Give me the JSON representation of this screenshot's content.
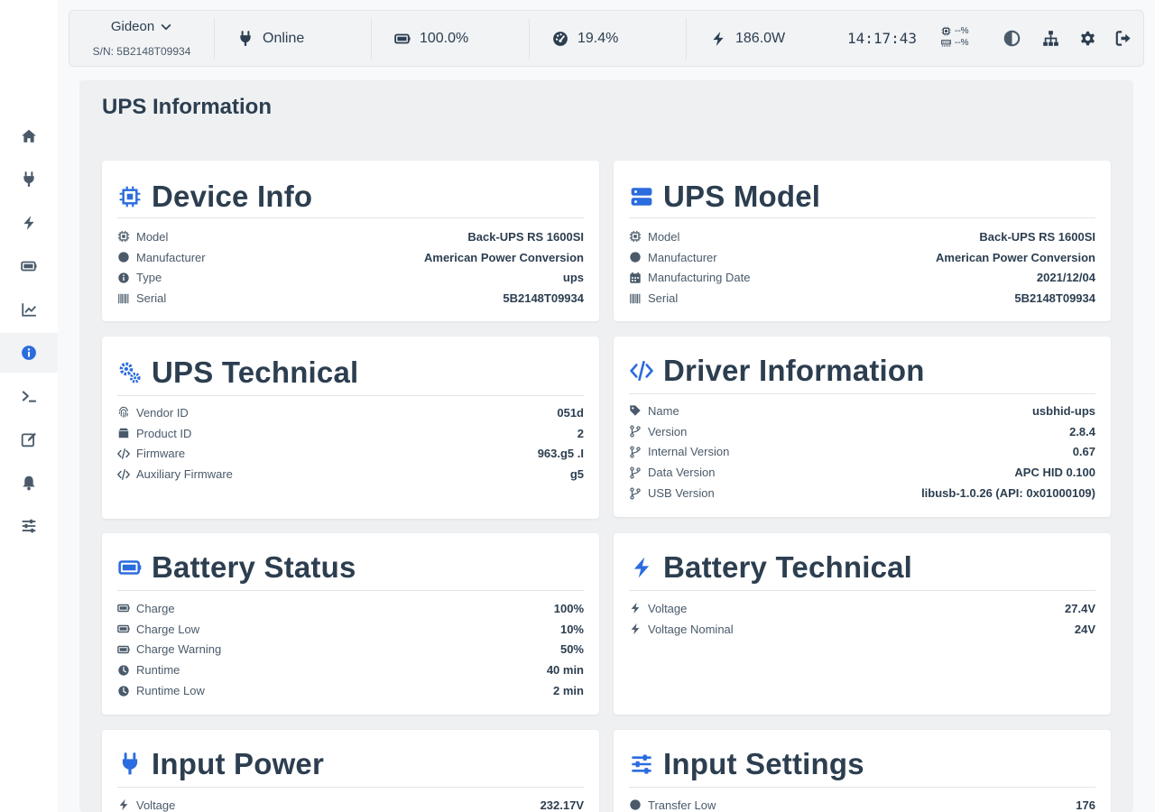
{
  "colors": {
    "accent": "#2b6cde",
    "text": "#2c3e50",
    "muted": "#4a5a6a",
    "icon": "#4a5a6a"
  },
  "sidebar": {
    "items": [
      {
        "icon": "home-icon"
      },
      {
        "icon": "plug-icon"
      },
      {
        "icon": "bolt-icon"
      },
      {
        "icon": "battery-icon"
      },
      {
        "icon": "chart-line-icon"
      },
      {
        "icon": "info-icon",
        "active": true
      },
      {
        "icon": "terminal-icon"
      },
      {
        "icon": "edit-icon"
      },
      {
        "icon": "bell-icon"
      },
      {
        "icon": "sliders-icon"
      }
    ]
  },
  "header": {
    "device_name": "Gideon",
    "serial": "S/N: 5B2148T09934",
    "status": "Online",
    "battery": "100.0%",
    "load": "19.4%",
    "power": "186.0W",
    "time": "14:17:43",
    "cpu": "--%",
    "memory": "--%"
  },
  "page": {
    "title": "UPS Information"
  },
  "cards": {
    "device_info": {
      "title": "Device Info",
      "rows": [
        {
          "label": "Model",
          "value": "Back-UPS RS 1600SI",
          "icon": "chip-icon"
        },
        {
          "label": "Manufacturer",
          "value": "American Power Conversion",
          "icon": "circle-icon"
        },
        {
          "label": "Type",
          "value": "ups",
          "icon": "info-icon"
        },
        {
          "label": "Serial",
          "value": "5B2148T09934",
          "icon": "barcode-icon"
        }
      ]
    },
    "ups_model": {
      "title": "UPS Model",
      "rows": [
        {
          "label": "Model",
          "value": "Back-UPS RS 1600SI",
          "icon": "chip-icon"
        },
        {
          "label": "Manufacturer",
          "value": "American Power Conversion",
          "icon": "circle-icon"
        },
        {
          "label": "Manufacturing Date",
          "value": "2021/12/04",
          "icon": "calendar-icon"
        },
        {
          "label": "Serial",
          "value": "5B2148T09934",
          "icon": "barcode-icon"
        }
      ]
    },
    "ups_technical": {
      "title": "UPS Technical",
      "rows": [
        {
          "label": "Vendor ID",
          "value": "051d",
          "icon": "fingerprint-icon"
        },
        {
          "label": "Product ID",
          "value": "2",
          "icon": "box-icon"
        },
        {
          "label": "Firmware",
          "value": "963.g5 .I",
          "icon": "code-icon"
        },
        {
          "label": "Auxiliary Firmware",
          "value": "g5",
          "icon": "code-icon"
        }
      ]
    },
    "driver_info": {
      "title": "Driver Information",
      "rows": [
        {
          "label": "Name",
          "value": "usbhid-ups",
          "icon": "tag-icon"
        },
        {
          "label": "Version",
          "value": "2.8.4",
          "icon": "branch-icon"
        },
        {
          "label": "Internal Version",
          "value": "0.67",
          "icon": "branch-icon"
        },
        {
          "label": "Data Version",
          "value": "APC HID 0.100",
          "icon": "branch-icon"
        },
        {
          "label": "USB Version",
          "value": "libusb-1.0.26 (API: 0x01000109)",
          "icon": "branch-icon"
        }
      ]
    },
    "battery_status": {
      "title": "Battery Status",
      "rows": [
        {
          "label": "Charge",
          "value": "100%",
          "icon": "battery-icon"
        },
        {
          "label": "Charge Low",
          "value": "10%",
          "icon": "battery-icon"
        },
        {
          "label": "Charge Warning",
          "value": "50%",
          "icon": "battery-icon"
        },
        {
          "label": "Runtime",
          "value": "40 min",
          "icon": "clock-icon"
        },
        {
          "label": "Runtime Low",
          "value": "2 min",
          "icon": "clock-icon"
        }
      ]
    },
    "battery_technical": {
      "title": "Battery Technical",
      "rows": [
        {
          "label": "Voltage",
          "value": "27.4V",
          "icon": "bolt-icon"
        },
        {
          "label": "Voltage Nominal",
          "value": "24V",
          "icon": "bolt-icon"
        }
      ]
    },
    "input_power": {
      "title": "Input Power",
      "rows": [
        {
          "label": "Voltage",
          "value": "232.17V",
          "icon": "bolt-icon"
        }
      ]
    },
    "input_settings": {
      "title": "Input Settings",
      "rows": [
        {
          "label": "Transfer Low",
          "value": "176",
          "icon": "circle-icon"
        }
      ]
    }
  }
}
